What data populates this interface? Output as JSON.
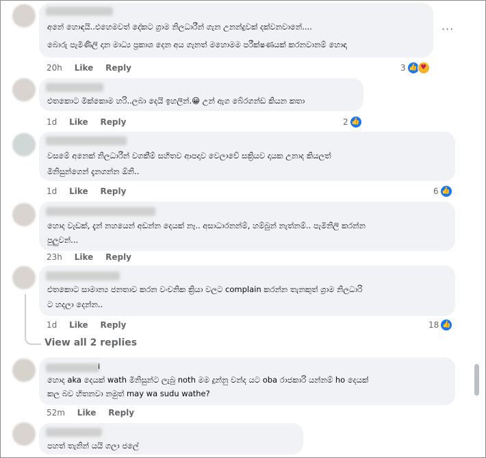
{
  "comments": [
    {
      "lines": [
        "අනේ හොඳයි..එහෙමවත් දේකට ග්‍රාම නිලධාරීන් ගැන උනන්දුවක් දක්වනවානේ....",
        "බොරු පැමිණිලි දාන මාධ්‍ය ප්‍රකාශ දෙන අය ගැනත් මහොමම පරීක්ෂණයක් කරනවානම් හොඳා"
      ],
      "time": "20h",
      "like": "Like",
      "reply": "Reply",
      "reactions": "3"
    },
    {
      "lines": [
        "එතකොට මික්කොම හරි..ලබා දෙයි ඉහලින්.😀 උන් ඇග බේරගන්ඩ කියන කතා"
      ],
      "time": "1d",
      "like": "Like",
      "reply": "Reply",
      "reactions": "2"
    },
    {
      "lines": [
        "වසමේ අනෙක් නිලධාරීන් වගකීම් සහිතව ආපදාව වෙලාවේ සක්‍රියව දායක උනාද කියලත්",
        "මිනිසුන්ගෙන් දැනගන්න ඕනි.."
      ],
      "time": "1d",
      "like": "Like",
      "reply": "Reply",
      "reactions": "6"
    },
    {
      "lines": [
        "හොද වැඩක්, දැන් නහයෙන් අඩන්න දෙයක් නෑ.. අසාධාරනන්ම්, හම්බුන් නැත්නම්.. පැමිනිලි කරන්න",
        "පුලුවන්..."
      ],
      "time": "23h",
      "like": "Like",
      "reply": "Reply",
      "reactions": ""
    },
    {
      "lines": [
        "එතකොට සාමාන්‍ය ජනතාව කරන වංචනික ක්‍රියා වලට complain කරන්න තැනකුත් ග්‍රාම නිලධාරි",
        "ට හදලා දෙන්න.."
      ],
      "time": "1d",
      "like": "Like",
      "reply": "Reply",
      "reactions": "18"
    },
    {
      "lines": [
        "හොද aka දෙයක් wath මිනිසුන්ට ලැබු noth මම දුන්නු චන්ද යට oba රාජකාරි යන්නම් ho දෙයක්",
        "කල බව හිතනවා නමුත් may wa sudu wathe?"
      ],
      "time": "52m",
      "like": "Like",
      "reply": "Reply",
      "reactions": ""
    },
    {
      "lines": [
        "පහත් තැනින් යයි ගලා ජලේ"
      ],
      "time": "",
      "like": "",
      "reply": "",
      "reactions": ""
    }
  ],
  "view_replies": "View all 2 replies",
  "name_fragment": "i",
  "more_icon": "more-options-icon"
}
